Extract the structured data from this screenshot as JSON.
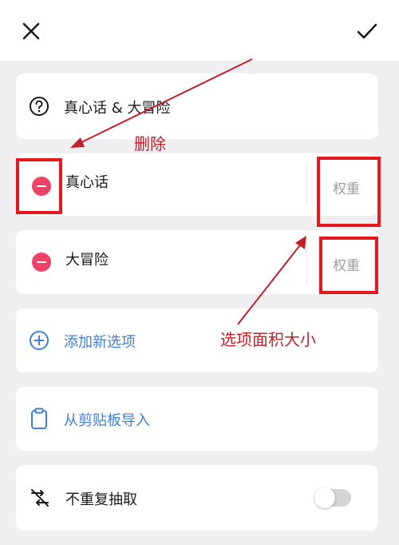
{
  "header": {
    "close_icon": "close-icon",
    "confirm_icon": "check-icon"
  },
  "title_row": {
    "icon": "question-circle-icon",
    "label": "真心话 & 大冒险"
  },
  "options": [
    {
      "label": "真心话",
      "weight_label": "权重",
      "delete_icon": "minus-circle-icon"
    },
    {
      "label": "大冒险",
      "weight_label": "权重",
      "delete_icon": "minus-circle-icon"
    }
  ],
  "add_option": {
    "icon": "plus-circle-icon",
    "label": "添加新选项"
  },
  "import_clipboard": {
    "icon": "clipboard-icon",
    "label": "从剪贴板导入"
  },
  "no_repeat": {
    "icon": "shuffle-off-icon",
    "label": "不重复抽取",
    "toggle_on": false
  },
  "annotations": {
    "delete": "删除",
    "weight_size": "选项面积大小"
  },
  "colors": {
    "delete_red": "#ee4367",
    "link_blue": "#3f7fd0",
    "annotation_red": "#c0202a",
    "highlight_box": "#e6181d"
  }
}
